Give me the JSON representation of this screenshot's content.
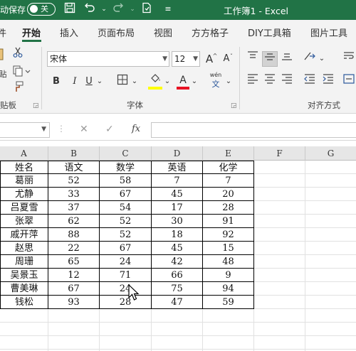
{
  "titlebar": {
    "autosave_label": "动保存",
    "toggle_label": "关",
    "doc_title": "工作簿1  -  Excel"
  },
  "ribbon_tabs": [
    "件",
    "开始",
    "插入",
    "页面布局",
    "视图",
    "方方格子",
    "DIY工具箱",
    "图片工具"
  ],
  "ribbon": {
    "font_name": "宋体",
    "font_size": "12",
    "clipboard_label": "贴板",
    "font_group_label": "字体",
    "align_group_label": "对齐方式",
    "bold": "B",
    "italic": "I",
    "underline": "U",
    "grow_font": "A",
    "shrink_font": "A",
    "phonetic_top": "wén",
    "phonetic_bottom": "文",
    "font_color_letter": "A",
    "fill_color": "#ffff00",
    "font_color": "#e81123"
  },
  "formula_bar": {
    "cancel_icon": "✕",
    "enter_icon": "✓",
    "fx_label": "fx",
    "value": ""
  },
  "columns": [
    "A",
    "B",
    "C",
    "D",
    "E",
    "F",
    "G"
  ],
  "table": {
    "headers": [
      "姓名",
      "语文",
      "数学",
      "英语",
      "化学"
    ],
    "rows": [
      [
        "葛丽",
        "52",
        "58",
        "7",
        "7"
      ],
      [
        "尤静",
        "33",
        "67",
        "45",
        "20"
      ],
      [
        "吕夏雪",
        "37",
        "54",
        "17",
        "28"
      ],
      [
        "张翠",
        "62",
        "52",
        "30",
        "91"
      ],
      [
        "戚开萍",
        "88",
        "52",
        "18",
        "92"
      ],
      [
        "赵思",
        "22",
        "67",
        "45",
        "15"
      ],
      [
        "周珊",
        "65",
        "24",
        "42",
        "48"
      ],
      [
        "吴景玉",
        "12",
        "71",
        "66",
        "9"
      ],
      [
        "曹美琳",
        "67",
        "24",
        "75",
        "94"
      ],
      [
        "钱松",
        "93",
        "28",
        "47",
        "59"
      ]
    ]
  },
  "colors": {
    "excel_green": "#217346",
    "ribbon_bg": "#f3f3f3"
  }
}
